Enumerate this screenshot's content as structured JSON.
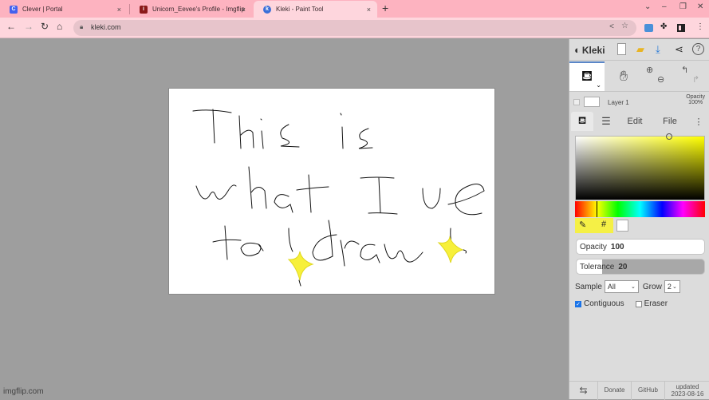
{
  "browser": {
    "tabs": [
      {
        "title": "Clever | Portal",
        "favicon": "clever-icon",
        "active": false
      },
      {
        "title": "Unicorn_Eevee's Profile - Imgflip",
        "favicon": "imgflip-icon",
        "active": false
      },
      {
        "title": "Kleki - Paint Tool",
        "favicon": "kleki-icon",
        "active": true
      }
    ],
    "new_tab": "+",
    "close_glyph": "×",
    "url": "kleki.com",
    "window_controls": {
      "dropdown": "⌄",
      "minimize": "–",
      "restore": "❐",
      "close": "✕"
    }
  },
  "app": {
    "logo": "Kleki",
    "layer": {
      "name": "Layer 1",
      "opacity_label": "Opacity",
      "opacity_value": "100%"
    },
    "panel_tabs": [
      "Edit",
      "File"
    ],
    "color": {
      "current_hex": "#ffff00",
      "secondary_hex": "#ffffff",
      "hex_label": "#"
    },
    "opacity": {
      "label": "Opacity",
      "value": "100",
      "fraction": 1.0
    },
    "tolerance": {
      "label": "Tolerance",
      "value": "20",
      "fraction": 0.2
    },
    "sample": {
      "label": "Sample",
      "value": "All"
    },
    "grow": {
      "label": "Grow",
      "value": "2"
    },
    "contiguous": {
      "label": "Contiguous",
      "checked": true
    },
    "eraser": {
      "label": "Eraser",
      "checked": false
    },
    "footer": {
      "donate": "Donate",
      "github": "GitHub",
      "updated_label": "updated",
      "updated_date": "2023-08-16"
    }
  },
  "canvas": {
    "handwritten_text": [
      "This is",
      "what I use",
      "to draw"
    ],
    "sparkle_color": "#f7f03a"
  },
  "watermark": "imgflip.com"
}
